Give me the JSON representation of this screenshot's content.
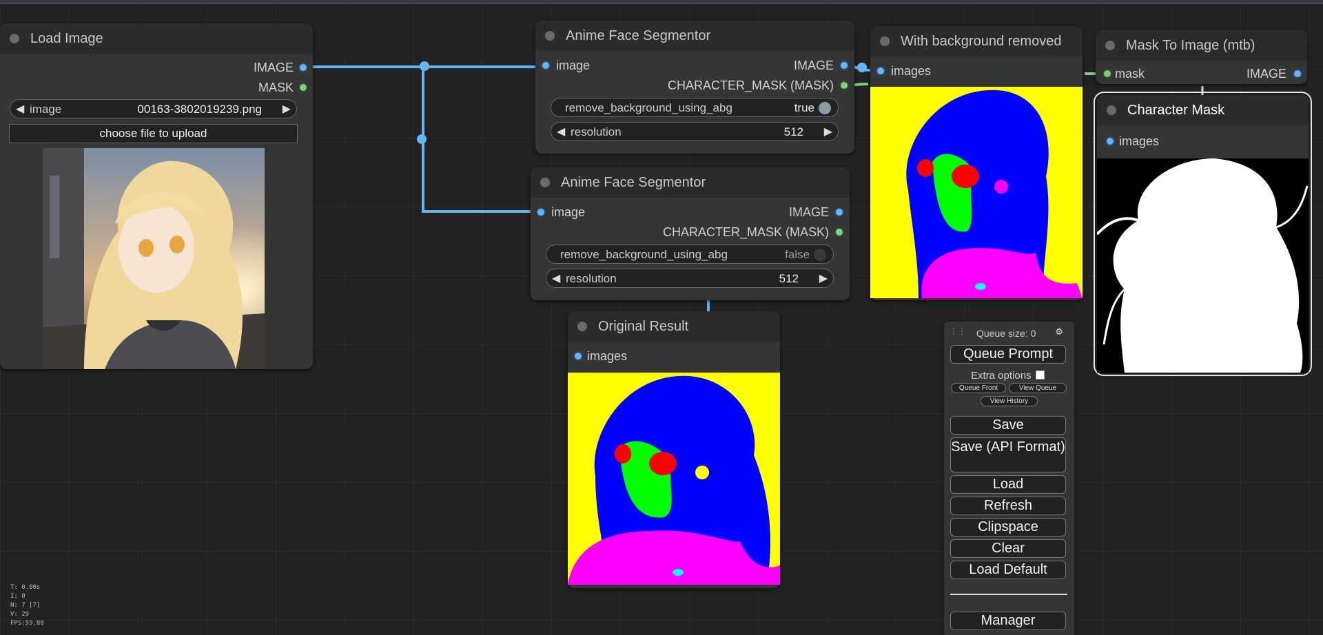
{
  "load_image": {
    "title": "Load Image",
    "outputs": [
      "IMAGE",
      "MASK"
    ],
    "image_widget": {
      "label": "image",
      "value": "00163-3802019239.png"
    },
    "upload_button": "choose file to upload"
  },
  "segmentor_top": {
    "title": "Anime Face Segmentor",
    "input": "image",
    "outputs": [
      "IMAGE",
      "CHARACTER_MASK (MASK)"
    ],
    "remove_bg": {
      "label": "remove_background_using_abg",
      "value": "true"
    },
    "resolution": {
      "label": "resolution",
      "value": "512"
    }
  },
  "segmentor_bottom": {
    "title": "Anime Face Segmentor",
    "input": "image",
    "outputs": [
      "IMAGE",
      "CHARACTER_MASK (MASK)"
    ],
    "remove_bg": {
      "label": "remove_background_using_abg",
      "value": "false"
    },
    "resolution": {
      "label": "resolution",
      "value": "512"
    }
  },
  "bg_removed": {
    "title": "With background removed",
    "input": "images"
  },
  "mask_to_image": {
    "title": "Mask To Image (mtb)",
    "input": "mask",
    "output": "IMAGE"
  },
  "character_mask": {
    "title": "Character Mask",
    "input": "images"
  },
  "original_result": {
    "title": "Original Result",
    "input": "images"
  },
  "queue": {
    "size_label": "Queue size: 0",
    "queue_prompt": "Queue Prompt",
    "extra_options": "Extra options",
    "queue_front": "Queue Front",
    "view_queue": "View Queue",
    "view_history": "View History",
    "buttons": [
      "Save",
      "Save (API Format)",
      "Load",
      "Refresh",
      "Clipspace",
      "Clear",
      "Load Default"
    ],
    "manager": "Manager"
  },
  "stats": [
    "T: 0.00s",
    "I: 0",
    "N: 7 [7]",
    "V: 29",
    "FPS:59.88"
  ],
  "colors": {
    "link_image": "#64b5f6",
    "link_mask": "#7fcf7f",
    "seg_yellow": "#ffff00",
    "seg_blue": "#0000ff",
    "seg_green": "#00ff00",
    "seg_magenta": "#ff00ff",
    "seg_red": "#ff0000"
  }
}
